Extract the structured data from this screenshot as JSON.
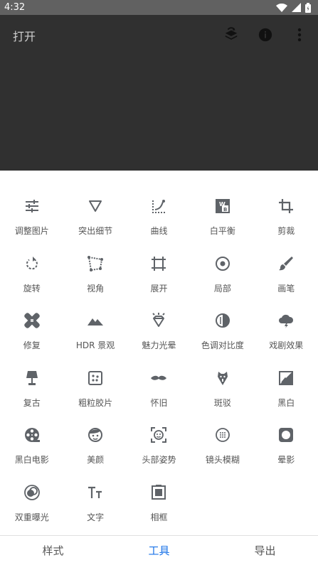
{
  "status": {
    "time": "4:32"
  },
  "toolbar": {
    "open_label": "打开"
  },
  "tools": [
    {
      "label": "调整图片",
      "icon": "tune-icon"
    },
    {
      "label": "突出细节",
      "icon": "triangle-down-icon"
    },
    {
      "label": "曲线",
      "icon": "curves-icon"
    },
    {
      "label": "白平衡",
      "icon": "white-balance-icon"
    },
    {
      "label": "剪裁",
      "icon": "crop-icon"
    },
    {
      "label": "旋转",
      "icon": "rotate-icon"
    },
    {
      "label": "视角",
      "icon": "perspective-icon"
    },
    {
      "label": "展开",
      "icon": "expand-icon"
    },
    {
      "label": "局部",
      "icon": "selective-icon"
    },
    {
      "label": "画笔",
      "icon": "brush-icon"
    },
    {
      "label": "修复",
      "icon": "healing-icon"
    },
    {
      "label": "HDR 景观",
      "icon": "mountain-icon"
    },
    {
      "label": "魅力光晕",
      "icon": "glamour-glow-icon"
    },
    {
      "label": "色调对比度",
      "icon": "tonal-contrast-icon"
    },
    {
      "label": "戏剧效果",
      "icon": "drama-cloud-icon"
    },
    {
      "label": "复古",
      "icon": "vintage-lamp-icon"
    },
    {
      "label": "粗粒胶片",
      "icon": "grainy-film-icon"
    },
    {
      "label": "怀旧",
      "icon": "mustache-icon"
    },
    {
      "label": "斑驳",
      "icon": "grunge-icon"
    },
    {
      "label": "黑白",
      "icon": "black-white-icon"
    },
    {
      "label": "黑白电影",
      "icon": "film-reel-icon"
    },
    {
      "label": "美颜",
      "icon": "face-icon"
    },
    {
      "label": "头部姿势",
      "icon": "head-pose-icon"
    },
    {
      "label": "镜头模糊",
      "icon": "lens-blur-icon"
    },
    {
      "label": "晕影",
      "icon": "vignette-icon"
    },
    {
      "label": "双重曝光",
      "icon": "double-exposure-icon"
    },
    {
      "label": "文字",
      "icon": "text-icon"
    },
    {
      "label": "相框",
      "icon": "frame-icon"
    }
  ],
  "nav": {
    "styles": "样式",
    "tools": "工具",
    "export": "导出"
  },
  "colors": {
    "accent": "#1a73e8",
    "icon": "#5f6368",
    "appbar": "#303030"
  }
}
